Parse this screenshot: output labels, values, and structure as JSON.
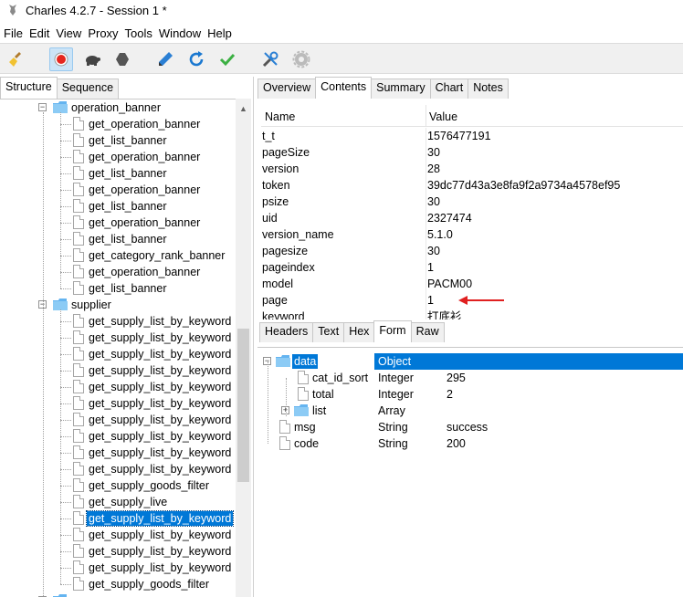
{
  "window": {
    "title": "Charles 4.2.7 - Session 1 *"
  },
  "menu": [
    "File",
    "Edit",
    "View",
    "Proxy",
    "Tools",
    "Window",
    "Help"
  ],
  "toolbar": {
    "icons": [
      "broom-icon",
      "record-icon",
      "throttle-turtle-icon",
      "breakpoint-hexagon-icon",
      "compose-pen-icon",
      "repeat-refresh-icon",
      "validate-check-icon",
      "tools-icon",
      "settings-gear-icon"
    ]
  },
  "left_tabs": [
    "Structure",
    "Sequence"
  ],
  "tree": {
    "folder1": "operation_banner",
    "folder1_items": [
      "get_operation_banner",
      "get_list_banner",
      "get_operation_banner",
      "get_list_banner",
      "get_operation_banner",
      "get_list_banner",
      "get_operation_banner",
      "get_list_banner",
      "get_category_rank_banner",
      "get_operation_banner",
      "get_list_banner"
    ],
    "folder2": "supplier",
    "folder2_items": [
      "get_supply_list_by_keyword",
      "get_supply_list_by_keyword",
      "get_supply_list_by_keyword",
      "get_supply_list_by_keyword",
      "get_supply_list_by_keyword",
      "get_supply_list_by_keyword",
      "get_supply_list_by_keyword",
      "get_supply_list_by_keyword",
      "get_supply_list_by_keyword",
      "get_supply_list_by_keyword",
      "get_supply_goods_filter",
      "get_supply_live",
      "get_supply_list_by_keyword",
      "get_supply_list_by_keyword",
      "get_supply_list_by_keyword",
      "get_supply_list_by_keyword",
      "get_supply_goods_filter"
    ],
    "selected_index": 12
  },
  "right_tabs": [
    "Overview",
    "Contents",
    "Summary",
    "Chart",
    "Notes"
  ],
  "right_tab_selected": 1,
  "request_table": {
    "headers": [
      "Name",
      "Value"
    ],
    "rows": [
      [
        "t_t",
        "1576477191"
      ],
      [
        "pageSize",
        "30"
      ],
      [
        "version",
        "28"
      ],
      [
        "token",
        "39dc77d43a3e8fa9f2a9734a4578ef95"
      ],
      [
        "psize",
        "30"
      ],
      [
        "uid",
        "2327474"
      ],
      [
        "version_name",
        "5.1.0"
      ],
      [
        "pagesize",
        "30"
      ],
      [
        "pageindex",
        "1"
      ],
      [
        "model",
        "PACM00"
      ],
      [
        "page",
        "1"
      ],
      [
        "keyword",
        "打底衫"
      ]
    ]
  },
  "sub_tabs": [
    "Headers",
    "Text",
    "Hex",
    "Form",
    "Raw"
  ],
  "sub_tab_selected": 3,
  "json_tree": [
    {
      "name": "data",
      "type": "Object",
      "value": ""
    },
    {
      "name": "cat_id_sort",
      "type": "Integer",
      "value": "295"
    },
    {
      "name": "total",
      "type": "Integer",
      "value": "2"
    },
    {
      "name": "list",
      "type": "Array",
      "value": ""
    },
    {
      "name": "msg",
      "type": "String",
      "value": "success"
    },
    {
      "name": "code",
      "type": "String",
      "value": "200"
    }
  ],
  "colors": {
    "selection": "#0078d7",
    "arrow": "#e02020"
  }
}
